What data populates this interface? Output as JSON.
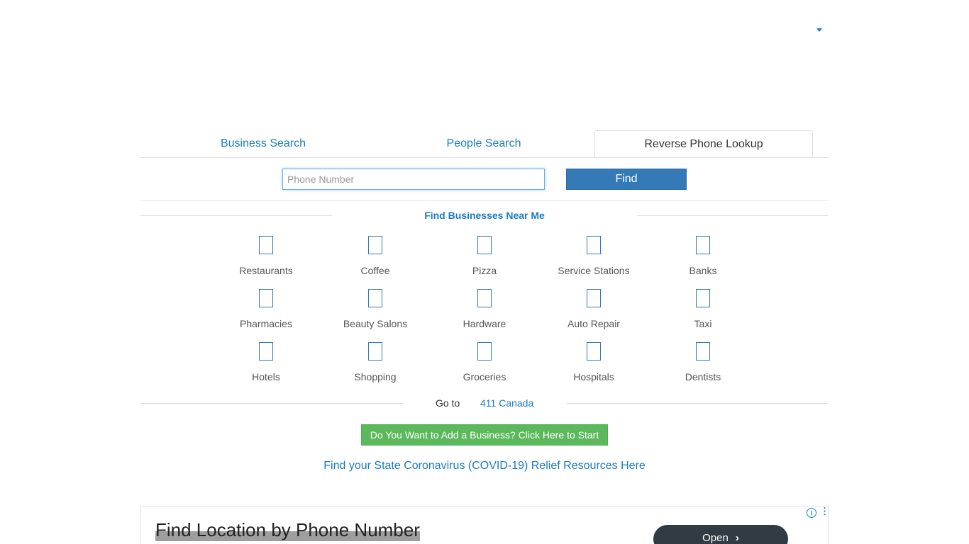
{
  "tabs": [
    {
      "label": "Business Search"
    },
    {
      "label": "People Search"
    },
    {
      "label": "Reverse Phone Lookup",
      "active": true
    }
  ],
  "search": {
    "placeholder": "Phone Number",
    "find_label": "Find"
  },
  "near_me": {
    "title": "Find Businesses Near Me",
    "categories": [
      "Restaurants",
      "Coffee",
      "Pizza",
      "Service Stations",
      "Banks",
      "Pharmacies",
      "Beauty Salons",
      "Hardware",
      "Auto Repair",
      "Taxi",
      "Hotels",
      "Shopping",
      "Groceries",
      "Hospitals",
      "Dentists"
    ]
  },
  "goto": {
    "label": "Go to",
    "link": "411 Canada"
  },
  "add_business_label": "Do You Want to Add a Business? Click Here to Start",
  "covid_link": "Find your State Coronavirus (COVID-19) Relief Resources Here",
  "ad": {
    "title": "Find Location by Phone Number",
    "open_label": "Open",
    "chevron": "›",
    "info": "i",
    "dots": "⋮"
  },
  "colors": {
    "link": "#1a7cc1",
    "primary_button": "#337ab7",
    "success_button": "#5cb85c"
  }
}
